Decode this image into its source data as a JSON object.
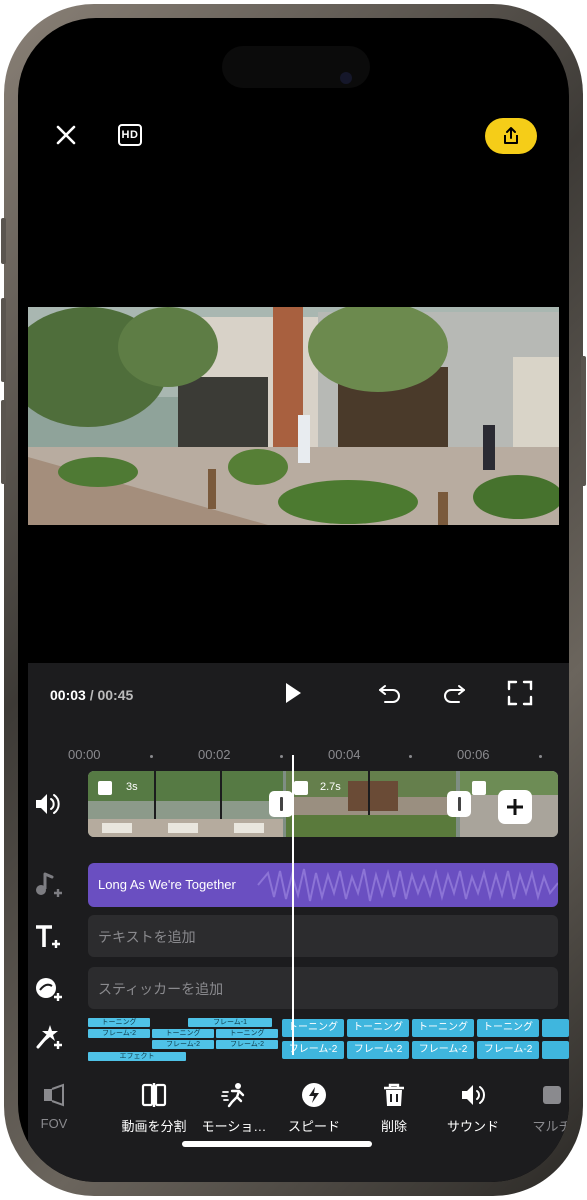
{
  "top_bar": {
    "hd_label": "HD"
  },
  "player": {
    "current_time": "00:03",
    "separator": "/",
    "total_time": "00:45"
  },
  "ruler": {
    "ticks": [
      "00:00",
      "00:02",
      "00:04",
      "00:06"
    ]
  },
  "video_track": {
    "clips": [
      {
        "duration": "3s"
      },
      {
        "duration": "2.7s"
      }
    ]
  },
  "audio_track": {
    "title": "Long As We're Together"
  },
  "text_track": {
    "placeholder": "テキストを追加"
  },
  "sticker_track": {
    "placeholder": "スティッカーを追加"
  },
  "effects": {
    "small_left": [
      "トーニング",
      "フレーム-2",
      "エフェクト",
      "トーニング",
      "フレーム-2",
      "トーニング",
      "フレーム-2",
      "フレーム-1"
    ],
    "big": [
      "トーニング",
      "トーニング",
      "トーニング",
      "トーニング",
      "フレーム-2",
      "フレーム-2",
      "フレーム-2",
      "フレーム-2"
    ]
  },
  "toolbar": [
    {
      "label": "FOV",
      "icon": "fov-icon",
      "dim": true
    },
    {
      "label": "動画を分割",
      "icon": "split-icon"
    },
    {
      "label": "モーショ…",
      "icon": "motion-icon"
    },
    {
      "label": "スピード",
      "icon": "speed-icon"
    },
    {
      "label": "削除",
      "icon": "delete-icon"
    },
    {
      "label": "サウンド",
      "icon": "sound-icon"
    },
    {
      "label": "マルチ",
      "icon": "multi-icon",
      "dim": true
    }
  ],
  "colors": {
    "accent": "#f5cd18",
    "audio": "#6a4fc1",
    "effect": "#3fb6de"
  }
}
